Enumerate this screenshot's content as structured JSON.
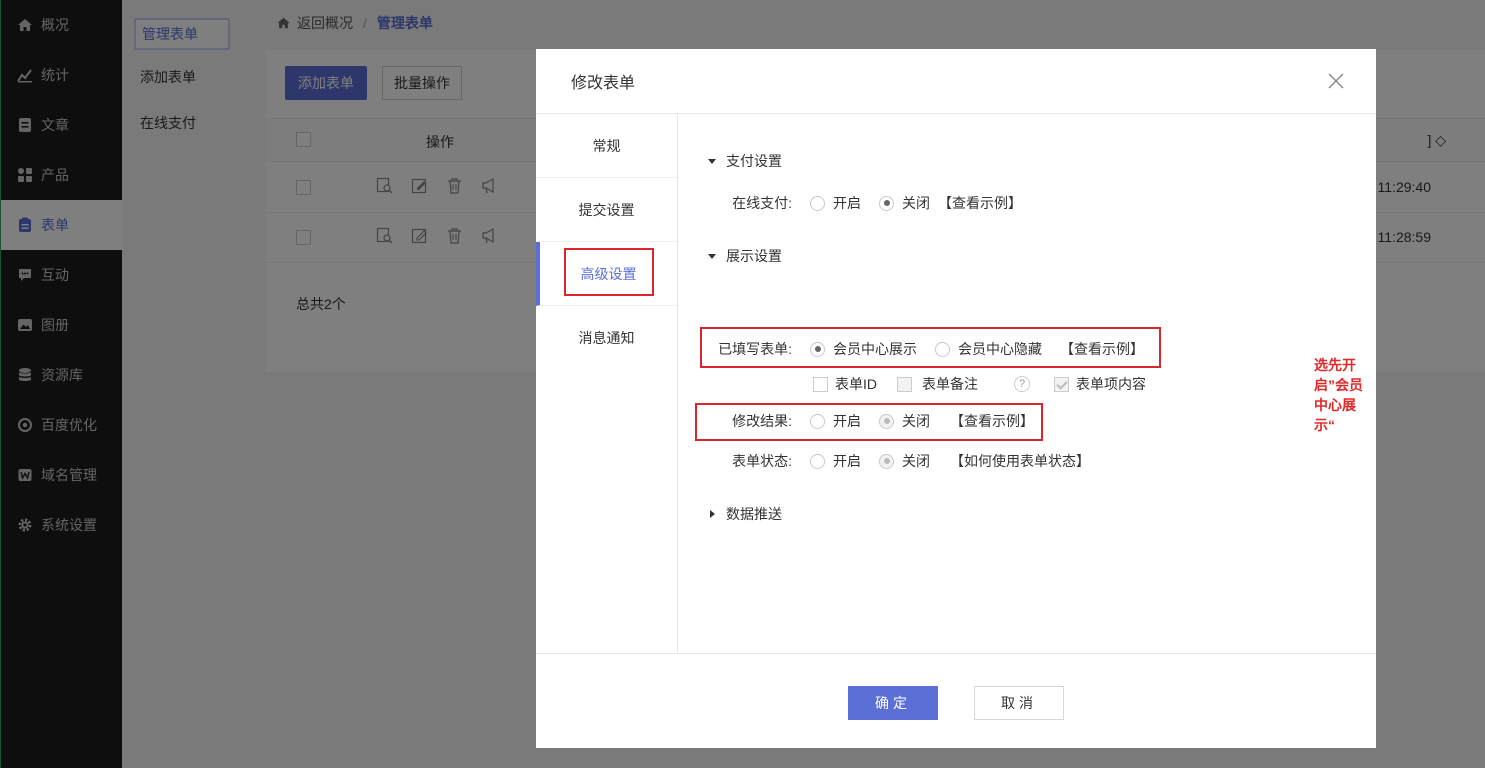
{
  "sidebar": {
    "items": [
      {
        "label": "概况",
        "icon": "home-icon"
      },
      {
        "label": "统计",
        "icon": "stats-icon"
      },
      {
        "label": "文章",
        "icon": "article-icon"
      },
      {
        "label": "产品",
        "icon": "grid-icon"
      },
      {
        "label": "表单",
        "icon": "clipboard-icon",
        "active": true
      },
      {
        "label": "互动",
        "icon": "chat-icon"
      },
      {
        "label": "图册",
        "icon": "image-icon"
      },
      {
        "label": "资源库",
        "icon": "database-icon"
      },
      {
        "label": "百度优化",
        "icon": "seo-icon"
      },
      {
        "label": "域名管理",
        "icon": "domain-icon"
      },
      {
        "label": "系统设置",
        "icon": "gear-icon"
      }
    ]
  },
  "submenu": {
    "items": [
      {
        "label": "管理表单",
        "active": true
      },
      {
        "label": "添加表单"
      },
      {
        "label": "在线支付"
      }
    ]
  },
  "breadcrumb": {
    "back": "返回概况",
    "separator": "/",
    "current": "管理表单"
  },
  "toolbar": {
    "add_label": "添加表单",
    "batch_label": "批量操作"
  },
  "table": {
    "op_header": "操作",
    "tail_header": "] ◇",
    "rows": [
      {
        "time": "11:29:40"
      },
      {
        "time": "11:28:59"
      }
    ],
    "total": "总共2个"
  },
  "modal": {
    "title": "修改表单",
    "tabs": [
      {
        "label": "常规"
      },
      {
        "label": "提交设置"
      },
      {
        "label": "高级设置",
        "active": true
      },
      {
        "label": "消息通知"
      }
    ],
    "pay_section": {
      "title": "支付设置",
      "online_pay_label": "在线支付:",
      "on_label": "开启",
      "off_label": "关闭",
      "example_link": "【查看示例】"
    },
    "display_section": {
      "title": "展示设置",
      "filled_label": "已填写表单:",
      "show_label": "会员中心展示",
      "hide_label": "会员中心隐藏",
      "example_link": "【查看示例】",
      "note": "选先开启”会员中心展示“",
      "checkbox_id": "表单ID",
      "checkbox_remark": "表单备注",
      "help": "?",
      "checkbox_content": "表单项内容",
      "modify_label": "修改结果:",
      "modify_on": "开启",
      "modify_off": "关闭",
      "modify_example": "【查看示例】",
      "status_label": "表单状态:",
      "status_on": "开启",
      "status_off": "关闭",
      "status_link": "【如何使用表单状态】"
    },
    "push_section": {
      "title": "数据推送"
    },
    "ok_label": "确定",
    "cancel_label": "取消"
  }
}
